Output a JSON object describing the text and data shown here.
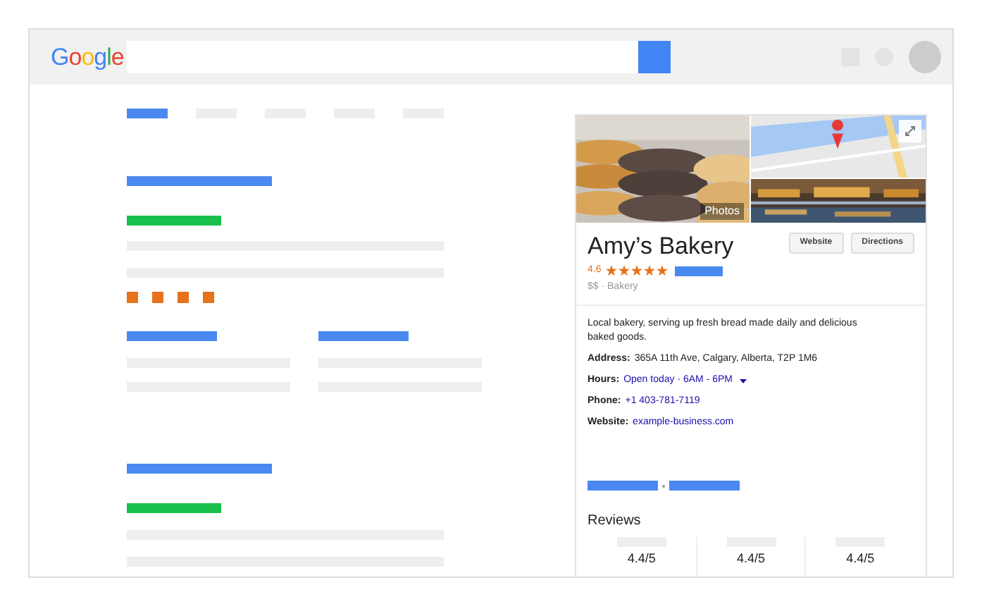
{
  "header": {
    "logo": "Google"
  },
  "panel": {
    "photos_label": "Photos",
    "title": "Amy’s Bakery",
    "buttons": [
      "Website",
      "Directions"
    ],
    "rating": "4.6",
    "stars": 5,
    "price_category": "$$ · Bakery",
    "description": "Local bakery, serving up fresh bread made daily and delicious baked goods.",
    "details": [
      {
        "label": "Address:",
        "value": "365A 11th Ave, Calgary, Alberta, T2P 1M6",
        "kind": "text"
      },
      {
        "label": "Hours:",
        "value": "Open today · 6AM - 6PM",
        "kind": "dropdown"
      },
      {
        "label": "Phone:",
        "value": "+1 403-781-7119",
        "kind": "link"
      },
      {
        "label": "Website:",
        "value": "example-business.com",
        "kind": "link"
      }
    ],
    "reviews_heading": "Reviews",
    "review_scores": [
      "4.4/5",
      "4.4/5",
      "4.4/5"
    ]
  }
}
